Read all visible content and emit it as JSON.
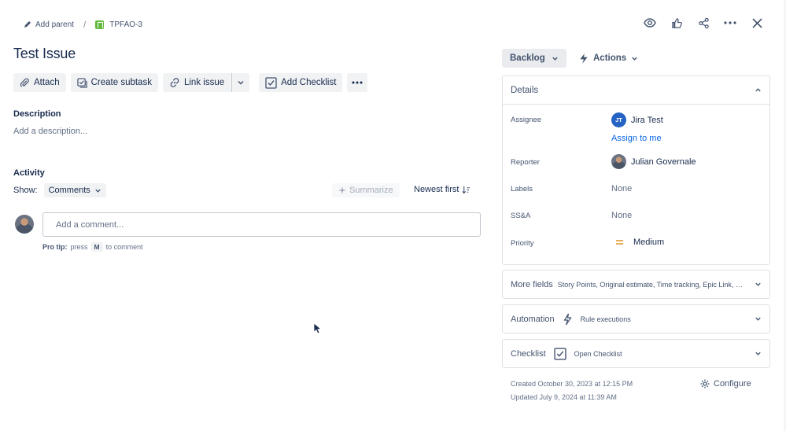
{
  "breadcrumb": {
    "add_parent": "Add parent",
    "separator": "/",
    "issue_key": "TPFAO-3"
  },
  "issue": {
    "title": "Test Issue"
  },
  "toolbar": {
    "attach": "Attach",
    "create_subtask": "Create subtask",
    "link_issue": "Link issue",
    "add_checklist": "Add Checklist"
  },
  "description": {
    "heading": "Description",
    "placeholder": "Add a description..."
  },
  "activity": {
    "heading": "Activity",
    "show_label": "Show:",
    "filter": "Comments",
    "summarize": "Summarize",
    "sort": "Newest first",
    "comment_placeholder": "Add a comment...",
    "pro_tip_prefix": "Pro tip:",
    "pro_tip_press": "press",
    "pro_tip_key": "M",
    "pro_tip_suffix": "to comment"
  },
  "status": {
    "label": "Backlog"
  },
  "actions": {
    "label": "Actions"
  },
  "details": {
    "heading": "Details",
    "assignee_label": "Assignee",
    "assignee_initials": "JT",
    "assignee_name": "Jira Test",
    "assign_to_me": "Assign to me",
    "reporter_label": "Reporter",
    "reporter_name": "Julian Governale",
    "labels_label": "Labels",
    "labels_value": "None",
    "ssa_label": "SS&A",
    "ssa_value": "None",
    "priority_label": "Priority",
    "priority_value": "Medium"
  },
  "more_fields": {
    "title": "More fields",
    "summary": "Story Points, Original estimate, Time tracking, Epic Link, C..."
  },
  "automation": {
    "title": "Automation",
    "subtitle": "Rule executions"
  },
  "checklist": {
    "title": "Checklist",
    "subtitle": "Open Checklist"
  },
  "meta": {
    "created": "Created October 30, 2023 at 12:15 PM",
    "updated": "Updated July 9, 2024 at 11:39 AM",
    "configure": "Configure"
  },
  "colors": {
    "accent": "#0c66e4",
    "story_green": "#63ba3c",
    "priority_orange": "#e2a03f",
    "jt_avatar": "#2463c4"
  }
}
